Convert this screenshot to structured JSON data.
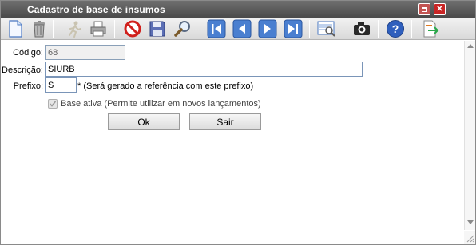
{
  "window": {
    "title": "Cadastro de base de insumos"
  },
  "toolbar": {
    "tools": [
      "new-document-icon",
      "trash-icon",
      "running-man-icon",
      "printer-icon",
      "cancel-icon",
      "save-disk-icon",
      "search-magnifier-icon",
      "first-record-icon",
      "previous-record-icon",
      "next-record-icon",
      "last-record-icon",
      "report-preview-icon",
      "camera-icon",
      "help-icon",
      "exit-door-icon"
    ]
  },
  "form": {
    "codigo": {
      "label": "Código:",
      "value": "68"
    },
    "descricao": {
      "label": "Descrição:",
      "value": "SIURB"
    },
    "prefixo": {
      "label": "Prefixo:",
      "value": "S",
      "hint": "* (Será gerado a referência com este prefixo)"
    },
    "base_ativa": {
      "label": "Base ativa (Permite utilizar em novos lançamentos)",
      "checked": true
    },
    "ok_label": "Ok",
    "sair_label": "Sair"
  },
  "colors": {
    "titlebar": "#555555",
    "close_button": "#c92525",
    "maximize_button": "#c25452",
    "input_border": "#7a95b8"
  }
}
